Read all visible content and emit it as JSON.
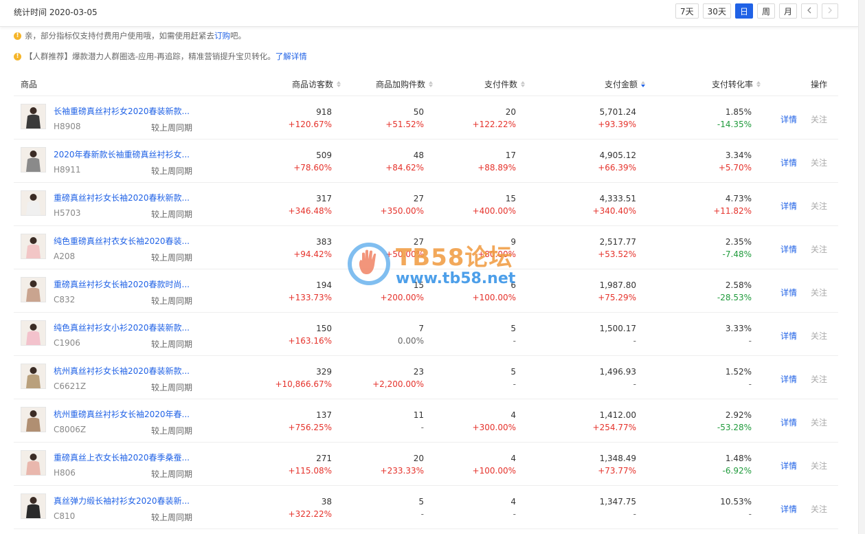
{
  "header": {
    "stat_label": "统计时间",
    "stat_date": "2020-03-05",
    "periods": [
      "7天",
      "30天",
      "日",
      "周",
      "月"
    ],
    "active_period": "日"
  },
  "notices": [
    {
      "text": "亲，部分指标仅支持付费用户使用哦，如需使用赶紧去 ",
      "link": "订购",
      "suffix": "吧。"
    },
    {
      "text": "【人群推荐】爆款潜力人群圈选-应用-再追踪，精准营销提升宝贝转化。",
      "link": "了解详情",
      "suffix": ""
    }
  ],
  "table": {
    "columns": [
      "商品",
      "商品访客数",
      "商品加购件数",
      "支付件数",
      "支付金额",
      "支付转化率",
      "操作"
    ],
    "sort_column": "支付金额",
    "compare_label": "较上周同期",
    "detail_label": "详情",
    "follow_label": "关注",
    "rows": [
      {
        "name": "长袖重磅真丝衬衫女2020春装新款...",
        "code": "H8908",
        "visitors": "918",
        "visitors_chg": "+120.67%",
        "cart": "50",
        "cart_chg": "+51.52%",
        "pay_qty": "20",
        "pay_qty_chg": "+122.22%",
        "amount": "5,701.24",
        "amount_chg": "+93.39%",
        "conv": "1.85%",
        "conv_chg": "-14.35%"
      },
      {
        "name": "2020年春新款长袖重磅真丝衬衫女...",
        "code": "H8911",
        "visitors": "509",
        "visitors_chg": "+78.60%",
        "cart": "48",
        "cart_chg": "+84.62%",
        "pay_qty": "17",
        "pay_qty_chg": "+88.89%",
        "amount": "4,905.12",
        "amount_chg": "+66.39%",
        "conv": "3.34%",
        "conv_chg": "+5.70%"
      },
      {
        "name": "重磅真丝衬衫女长袖2020春秋新款...",
        "code": "H5703",
        "visitors": "317",
        "visitors_chg": "+346.48%",
        "cart": "27",
        "cart_chg": "+350.00%",
        "pay_qty": "15",
        "pay_qty_chg": "+400.00%",
        "amount": "4,333.51",
        "amount_chg": "+340.40%",
        "conv": "4.73%",
        "conv_chg": "+11.82%"
      },
      {
        "name": "纯色重磅真丝衬衣女长袖2020春装...",
        "code": "A208",
        "visitors": "383",
        "visitors_chg": "+94.42%",
        "cart": "27",
        "cart_chg": "+50.00%",
        "pay_qty": "9",
        "pay_qty_chg": "+80.00%",
        "amount": "2,517.77",
        "amount_chg": "+53.52%",
        "conv": "2.35%",
        "conv_chg": "-7.48%"
      },
      {
        "name": "重磅真丝衬衫女长袖2020春款时尚...",
        "code": "C832",
        "visitors": "194",
        "visitors_chg": "+133.73%",
        "cart": "15",
        "cart_chg": "+200.00%",
        "pay_qty": "6",
        "pay_qty_chg": "+100.00%",
        "amount": "1,987.80",
        "amount_chg": "+75.29%",
        "conv": "2.58%",
        "conv_chg": "-28.53%"
      },
      {
        "name": "纯色真丝衬衫女小衫2020春装新款...",
        "code": "C1906",
        "visitors": "150",
        "visitors_chg": "+163.16%",
        "cart": "7",
        "cart_chg": "0.00%",
        "pay_qty": "5",
        "pay_qty_chg": "-",
        "amount": "1,500.17",
        "amount_chg": "-",
        "conv": "3.33%",
        "conv_chg": "-"
      },
      {
        "name": "杭州真丝衬衫女长袖2020春装新款...",
        "code": "C6621Z",
        "visitors": "329",
        "visitors_chg": "+10,866.67%",
        "cart": "23",
        "cart_chg": "+2,200.00%",
        "pay_qty": "5",
        "pay_qty_chg": "-",
        "amount": "1,496.93",
        "amount_chg": "-",
        "conv": "1.52%",
        "conv_chg": "-"
      },
      {
        "name": "杭州重磅真丝衬衫女长袖2020年春...",
        "code": "C8006Z",
        "visitors": "137",
        "visitors_chg": "+756.25%",
        "cart": "11",
        "cart_chg": "-",
        "pay_qty": "4",
        "pay_qty_chg": "+300.00%",
        "amount": "1,412.00",
        "amount_chg": "+254.77%",
        "conv": "2.92%",
        "conv_chg": "-53.28%"
      },
      {
        "name": "重磅真丝上衣女长袖2020春季桑蚕...",
        "code": "H806",
        "visitors": "271",
        "visitors_chg": "+115.08%",
        "cart": "20",
        "cart_chg": "+233.33%",
        "pay_qty": "4",
        "pay_qty_chg": "+100.00%",
        "amount": "1,348.49",
        "amount_chg": "+73.77%",
        "conv": "1.48%",
        "conv_chg": "-6.92%"
      },
      {
        "name": "真丝弹力缎长袖衬衫女2020春装新...",
        "code": "C810",
        "visitors": "38",
        "visitors_chg": "+322.22%",
        "cart": "5",
        "cart_chg": "-",
        "pay_qty": "4",
        "pay_qty_chg": "-",
        "amount": "1,347.75",
        "amount_chg": "-",
        "conv": "10.53%",
        "conv_chg": "-"
      }
    ]
  },
  "thumb_colors": [
    "#3a3a3a",
    "#8a8a8a",
    "#f0f0f0",
    "#f2c6c6",
    "#c9a48f",
    "#f3c2cc",
    "#b9a07c",
    "#b08f72",
    "#e9b7ad",
    "#2a2a2a"
  ],
  "watermark": {
    "title": "TB58论坛",
    "url": "www.tb58.net"
  },
  "colors": {
    "accent": "#2062e6",
    "up": "#e5322b",
    "down": "#1f9a3b"
  }
}
